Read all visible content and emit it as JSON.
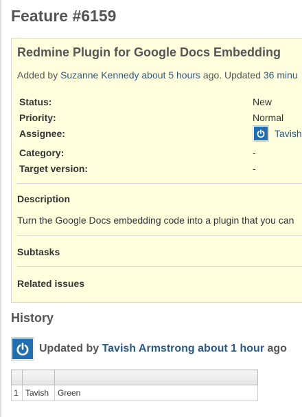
{
  "page": {
    "title": "Feature #6159"
  },
  "issue": {
    "subject": "Redmine Plugin for Google Docs Embedding",
    "added_by_prefix": "Added by ",
    "author": "Suzanne Kennedy",
    "created_ago": "about 5 hours",
    "updated_sep": " ago. Updated ",
    "updated_ago": "36 minu",
    "attributes": {
      "status_label": "Status:",
      "status_value": "New",
      "priority_label": "Priority:",
      "priority_value": "Normal",
      "assignee_label": "Assignee:",
      "assignee_value": "Tavish",
      "category_label": "Category:",
      "category_value": "-",
      "target_label": "Target version:",
      "target_value": "-"
    },
    "description_label": "Description",
    "description_text": "Turn the Google Docs embedding code into a plugin that you can",
    "subtasks_label": "Subtasks",
    "related_label": "Related issues"
  },
  "history": {
    "title": "History",
    "updated_by": "Updated by ",
    "user": "Tavish Armstrong",
    "time_ago": "about 1 hour",
    "ago_suffix": " ago",
    "rows": [
      {
        "num": "1",
        "name": "Tavish",
        "value": "Green"
      }
    ]
  },
  "colors": {
    "link": "#2a5a8a",
    "box_bg": "#ffffdd",
    "avatar": "#1f6fb1"
  },
  "icons": {
    "avatar": "power-logo-icon"
  }
}
